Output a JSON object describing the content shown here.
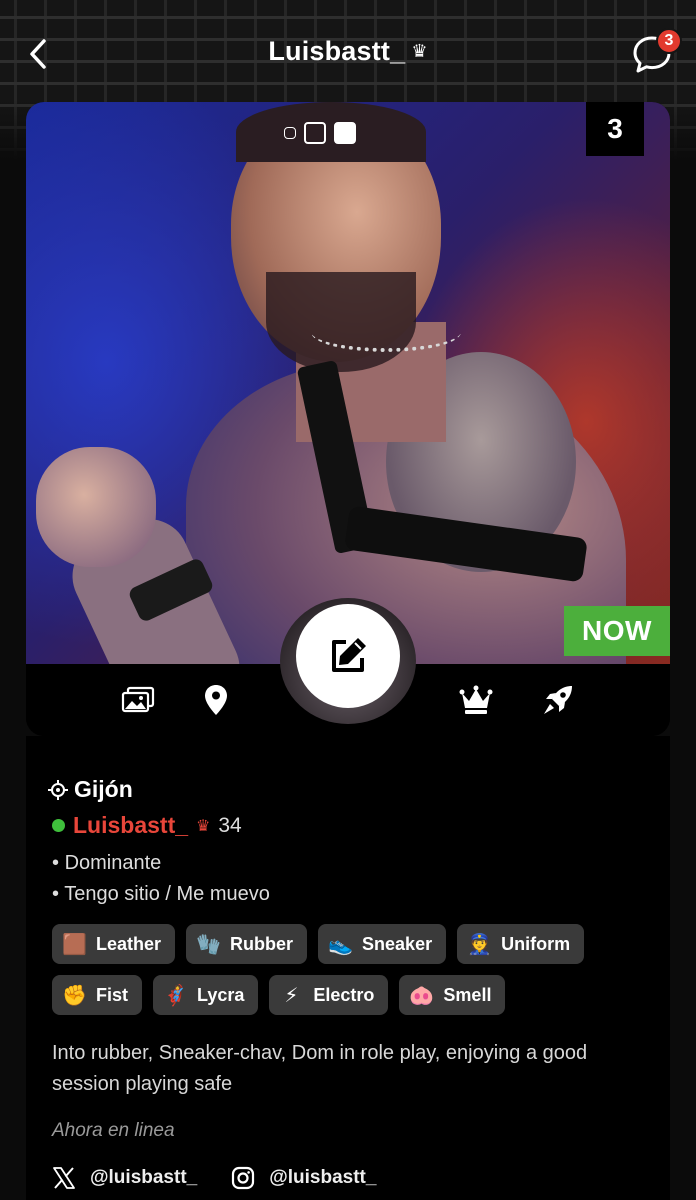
{
  "header": {
    "title": "Luisbastt_",
    "title_crown": "♛",
    "back_icon": "chevron-left-icon",
    "chat_icon": "chat-bubble-icon",
    "chat_badge": "3"
  },
  "photo": {
    "photo_count": "3",
    "indicator_dots": 3,
    "now_label": "NOW"
  },
  "actions": {
    "gallery_icon": "gallery-icon",
    "location_icon": "location-pin-icon",
    "edit_icon": "edit-icon",
    "crown_icon": "crown-icon",
    "rocket_icon": "rocket-icon"
  },
  "profile": {
    "location": "Gijón",
    "username": "Luisbastt_",
    "crown": "♛",
    "age": "34",
    "bullets": [
      "Dominante",
      "Tengo sitio / Me muevo"
    ],
    "tags_row1": [
      {
        "emoji": "🟫",
        "label": "Leather"
      },
      {
        "emoji": "🧤",
        "label": "Rubber"
      },
      {
        "emoji": "👟",
        "label": "Sneaker"
      },
      {
        "emoji": "👮",
        "label": "Uniform"
      }
    ],
    "tags_row2": [
      {
        "emoji": "✊",
        "label": "Fist"
      },
      {
        "emoji": "🦸",
        "label": "Lycra"
      },
      {
        "emoji": "⚡",
        "label": "Electro"
      },
      {
        "emoji": "🐽",
        "label": "Smell"
      }
    ],
    "description": "Into rubber, Sneaker-chav, Dom in role play, enjoying a good session playing safe",
    "status": "Ahora en linea",
    "socials": [
      {
        "icon": "x-icon",
        "handle": "@luisbastt_"
      },
      {
        "icon": "instagram-icon",
        "handle": "@luisbastt_"
      }
    ]
  },
  "colors": {
    "accent_red": "#e8463a",
    "online_green": "#3fbf3c",
    "now_green": "#4caf3c",
    "tag_bg": "#3a3a3a"
  }
}
